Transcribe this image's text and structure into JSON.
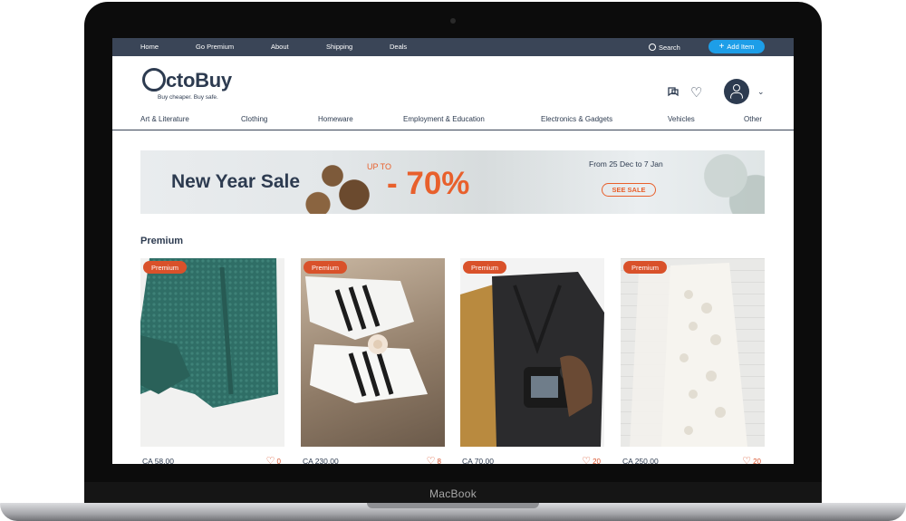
{
  "device": {
    "brand": "MacBook"
  },
  "topbar": {
    "links": [
      "Home",
      "Go Premium",
      "About",
      "Shipping",
      "Deals"
    ],
    "search_label": "Search",
    "add_item_label": "Add Item"
  },
  "header": {
    "logo_text": "ctoBuy",
    "tagline": "Buy cheaper. Buy safe."
  },
  "categories": [
    "Art & Literature",
    "Clothing",
    "Homeware",
    "Employment & Education",
    "Electronics & Gadgets",
    "Vehicles",
    "Other"
  ],
  "banner": {
    "title": "New Year Sale",
    "upto": "UP TO",
    "discount": "- 70%",
    "dates": "From 25 Dec to 7 Jan",
    "cta": "SEE SALE"
  },
  "section": {
    "title": "Premium"
  },
  "products": [
    {
      "badge": "Premium",
      "price": "CA 58.00",
      "likes": "0",
      "image": "green knit sweater"
    },
    {
      "badge": "Premium",
      "price": "CA 230.00",
      "likes": "8",
      "image": "white striped sneakers"
    },
    {
      "badge": "Premium",
      "price": "CA 70.00",
      "likes": "20",
      "image": "black coat with camera"
    },
    {
      "badge": "Premium",
      "price": "CA 250.00",
      "likes": "20",
      "image": "white lace dress"
    }
  ],
  "colors": {
    "nav": "#3a4557",
    "accent": "#1d9ee8",
    "orange": "#e8602c",
    "text": "#2d3b50"
  }
}
